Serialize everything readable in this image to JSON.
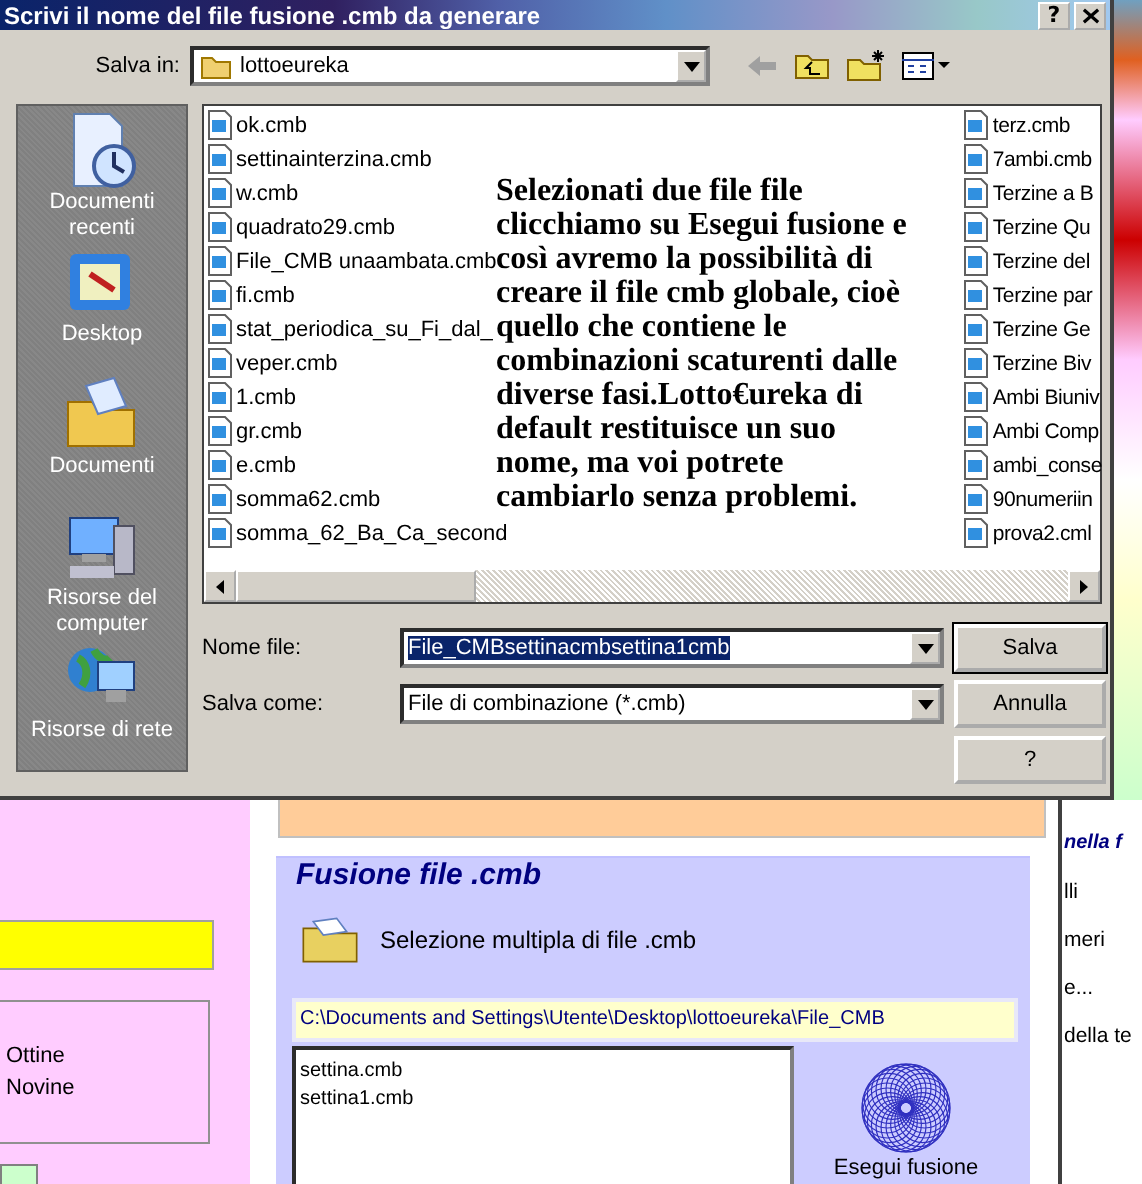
{
  "dialog": {
    "title": "Scrivi il nome del file fusione .cmb da generare",
    "help_button": "?",
    "save_in": {
      "label": "Salva in:",
      "value": "lottoeureka"
    },
    "places": [
      {
        "label": "Documenti recenti"
      },
      {
        "label": "Desktop"
      },
      {
        "label": "Documenti"
      },
      {
        "label": "Risorse del computer"
      },
      {
        "label": "Risorse di rete"
      }
    ],
    "files_column_1": [
      "ok.cmb",
      "settinainterzina.cmb",
      "w.cmb",
      "quadrato29.cmb",
      "File_CMB unaambata.cmb",
      "fi.cmb",
      "stat_periodica_su_Fi_dal_",
      "veper.cmb",
      "1.cmb",
      "gr.cmb",
      "e.cmb",
      "somma62.cmb",
      "somma_62_Ba_Ca_second"
    ],
    "files_column_3": [
      "terz.cmb",
      "7ambi.cmb",
      "Terzine a B",
      "Terzine Qu",
      "Terzine del",
      "Terzine par",
      "Terzine Ge",
      "Terzine Biv",
      "Ambi Biuniv",
      "Ambi Comp",
      "ambi_conse",
      "90numeriin",
      "prova2.cml"
    ],
    "annotation": "Selezionati due file file clicchiamo su Esegui fusione e così avremo la possibilità di creare il file cmb globale, cioè quello che contiene le combinazioni scaturenti dalle diverse fasi.Lotto€ureka di default restituisce un suo nome, ma voi potrete cambiarlo senza problemi.",
    "file_name": {
      "label": "Nome file:",
      "value": "File_CMBsettinacmbsettina1cmb"
    },
    "save_as": {
      "label": "Salva come:",
      "value": "File di combinazione (*.cmb)"
    },
    "buttons": [
      "Salva",
      "Annulla",
      "?"
    ]
  },
  "app": {
    "left_panel": {
      "options": [
        "Ottine",
        "Novine"
      ]
    },
    "fusion_panel": {
      "title": "Fusione file .cmb",
      "multi_select": "Selezione multipla di file .cmb",
      "path": "C:\\Documents and Settings\\Utente\\Desktop\\lottoeureka\\File_CMB",
      "files": [
        "settina.cmb",
        "settina1.cmb"
      ],
      "run_button": "Esegui fusione"
    },
    "right_column": [
      "nella f",
      "lli",
      "meri",
      "e...",
      "della te"
    ]
  }
}
